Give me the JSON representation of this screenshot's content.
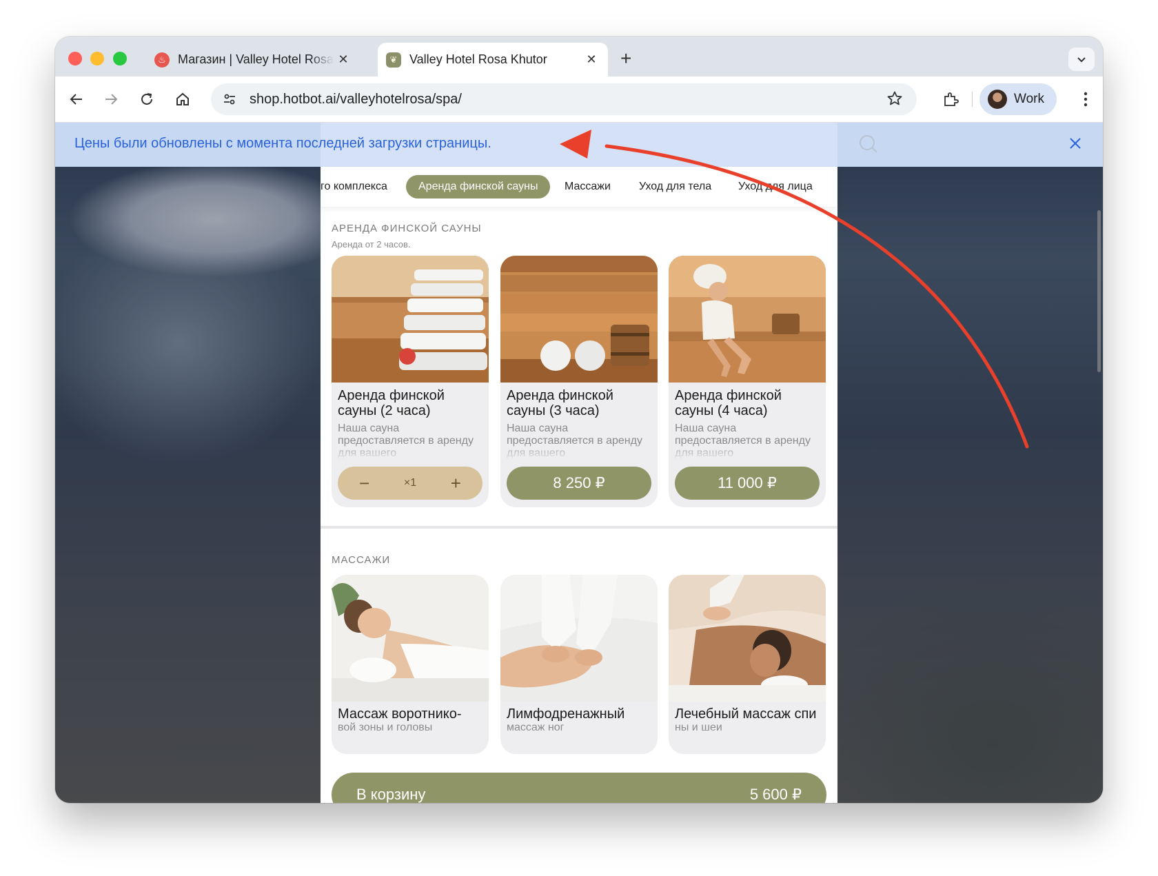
{
  "browser": {
    "tabs": [
      {
        "title": "Магазин | Valley Hotel Rosa Khutor",
        "active": false
      },
      {
        "title": "Valley Hotel Rosa Khutor",
        "active": true
      }
    ],
    "url": "shop.hotbot.ai/valleyhotelrosa/spa/",
    "profile_label": "Work"
  },
  "notice": {
    "text": "Цены были обновлены с момента последней загрузки страницы."
  },
  "categories": [
    {
      "label": "го комплекса",
      "active": false
    },
    {
      "label": "Аренда финской сауны",
      "active": true
    },
    {
      "label": "Массажи",
      "active": false
    },
    {
      "label": "Уход для тела",
      "active": false
    },
    {
      "label": "Уход для лица",
      "active": false
    }
  ],
  "sauna_section": {
    "title": "АРЕНДА ФИНСКОЙ САУНЫ",
    "subtitle": "Аренда от 2 часов.",
    "cards": [
      {
        "title": "Аренда финской сауны (2 часа)",
        "desc": "Наша сауна предоставляется в аренду для вашего",
        "quantity": "×1",
        "minus": "−",
        "plus": "+"
      },
      {
        "title": "Аренда финской сауны (3 часа)",
        "desc": "Наша сауна предоставляется в аренду для вашего",
        "price": "8 250 ₽"
      },
      {
        "title": "Аренда финской сауны (4 часа)",
        "desc": "Наша сауна предоставляется в аренду для вашего",
        "price": "11 000 ₽"
      }
    ]
  },
  "massage_section": {
    "title": "МАССАЖИ",
    "cards": [
      {
        "title": "Массаж воротнико-",
        "desc": "вой зоны и головы"
      },
      {
        "title": "Лимфодренажный",
        "desc": "массаж ног"
      },
      {
        "title": "Лечебный массаж спи",
        "desc": "ны и шеи"
      }
    ]
  },
  "cart": {
    "label": "В корзину",
    "total": "5 600 ₽"
  },
  "colors": {
    "accent_olive": "#8f9567",
    "stepper_tan": "#d7c29c",
    "notice_blue": "#2962d9",
    "annotation_red": "#e8402a"
  }
}
